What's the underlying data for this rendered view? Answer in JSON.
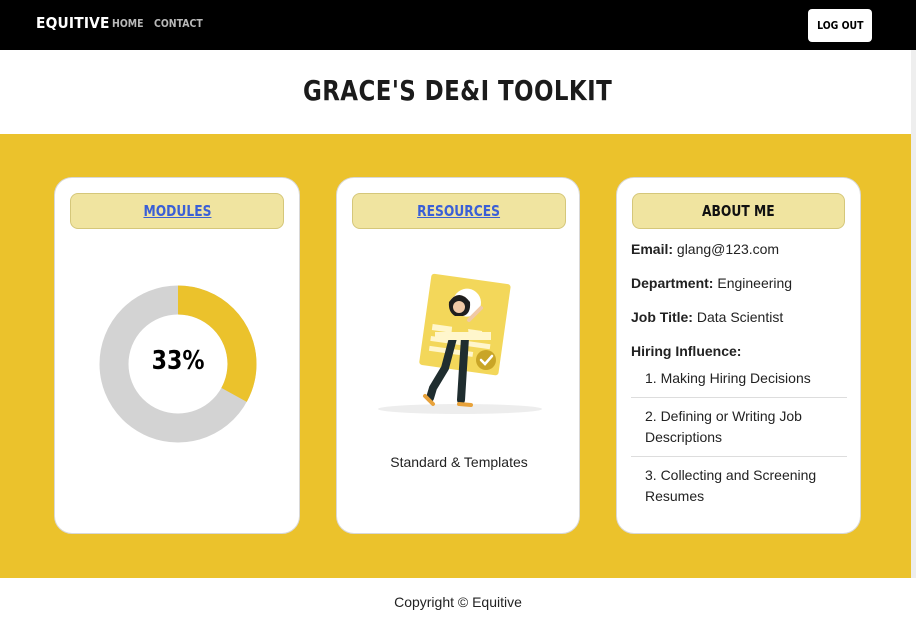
{
  "nav": {
    "brand": "EQUITIVE",
    "links": [
      "HOME",
      "CONTACT"
    ],
    "logout_label": "LOG OUT"
  },
  "page": {
    "title": "GRACE'S DE&I TOOLKIT"
  },
  "modules": {
    "header": "MODULES",
    "progress_label": "33%",
    "progress_fraction": 0.33,
    "fill_color": "#ebc22c",
    "track_color": "#d3d3d3"
  },
  "resources": {
    "header": "RESOURCES",
    "items": [
      {
        "label": "Standard & Templates",
        "icon": "resume-illustration-icon"
      }
    ]
  },
  "about": {
    "header": "ABOUT ME",
    "email_label": "Email:",
    "email_value": "glang@123.com",
    "department_label": "Department:",
    "department_value": "Engineering",
    "job_title_label": "Job Title:",
    "job_title_value": "Data Scientist",
    "hiring_influence_label": "Hiring Influence:",
    "hiring_influence": [
      "1. Making Hiring Decisions",
      "2. Defining or Writing Job Descriptions",
      "3. Collecting and Screening Resumes"
    ]
  },
  "footer": {
    "text": "Copyright © Equitive"
  },
  "colors": {
    "accent_yellow": "#ebc22c",
    "header_pill": "#f0e4a0",
    "link_blue": "#3a5fd6",
    "navbar": "#000000"
  }
}
